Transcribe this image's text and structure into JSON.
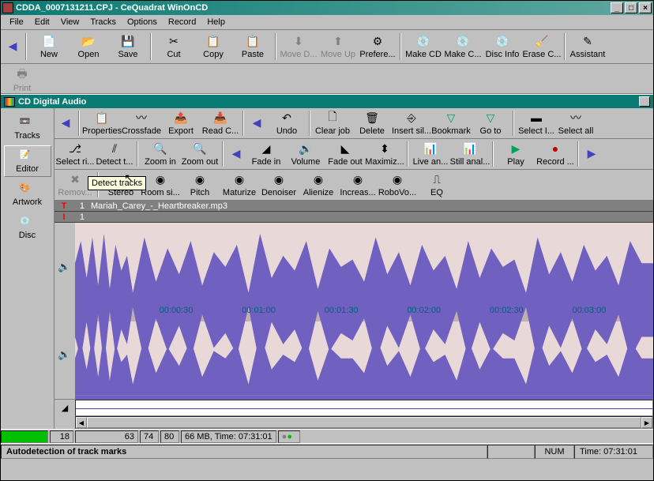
{
  "title": "CDDA_0007131211.CPJ - CeQuadrat WinOnCD",
  "menu": {
    "file": "File",
    "edit": "Edit",
    "view": "View",
    "tracks": "Tracks",
    "options": "Options",
    "record": "Record",
    "help": "Help"
  },
  "tb1": {
    "new": "New",
    "open": "Open",
    "save": "Save",
    "cut": "Cut",
    "copy": "Copy",
    "paste": "Paste",
    "moved": "Move D...",
    "moveu": "Move Up",
    "pref": "Prefere...",
    "makecd": "Make CD",
    "makec": "Make C...",
    "discinfo": "Disc Info",
    "erasec": "Erase C...",
    "assistant": "Assistant"
  },
  "print": "Print",
  "panel": "CD Digital Audio",
  "side": {
    "tracks": "Tracks",
    "editor": "Editor",
    "artwork": "Artwork",
    "disc": "Disc"
  },
  "r1": {
    "prop": "Properties",
    "cross": "Crossfade",
    "export": "Export",
    "readc": "Read C...",
    "undo": "Undo",
    "clear": "Clear job",
    "delete": "Delete",
    "insert": "Insert sil...",
    "bookmark": "Bookmark",
    "goto": "Go to",
    "seli": "Select I...",
    "selall": "Select all"
  },
  "r2": {
    "selri": "Select ri...",
    "detect": "Detect t...",
    "zoomin": "Zoom in",
    "zoomout": "Zoom out",
    "fadein": "Fade in",
    "volume": "Volume",
    "fadeout": "Fade out",
    "maximiz": "Maximiz...",
    "livean": "Live an...",
    "stillan": "Still anal...",
    "play": "Play",
    "record": "Record ..."
  },
  "r3": {
    "remov": "Remov...",
    "stereo": "Stereo",
    "roomsi": "Room si...",
    "pitch": "Pitch",
    "maturize": "Maturize",
    "denoiser": "Denoiser",
    "alienize": "Alienize",
    "increas": "Increas...",
    "robovo": "RoboVo...",
    "eq": "EQ"
  },
  "tooltip": "Detect tracks",
  "track": {
    "t": "T",
    "i": "I",
    "n": "1",
    "file": "Mariah_Carey_-_Heartbreaker.mp3"
  },
  "times": [
    "00:00:30",
    "00:01:00",
    "00:01:30",
    "00:02:00",
    "00:02:30",
    "00:03:00"
  ],
  "info": {
    "v1": "18",
    "v2": "63",
    "v3": "74",
    "v4": "80",
    "size": "66 MB, Time: 07:31:01"
  },
  "status": {
    "msg": "Autodetection of track marks",
    "num": "NUM",
    "time": "Time: 07:31:01"
  }
}
